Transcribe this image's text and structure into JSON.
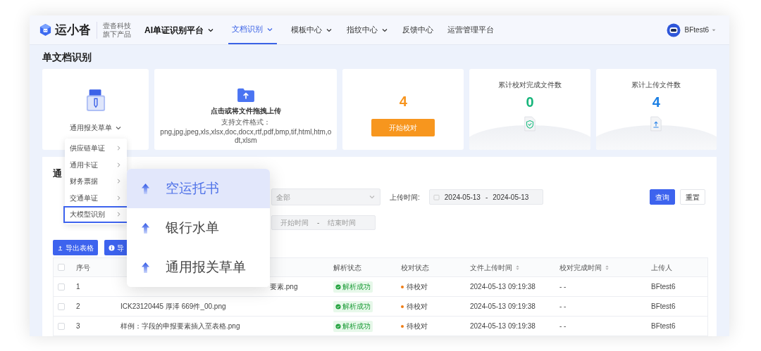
{
  "header": {
    "logo": {
      "name": "运小沓",
      "tagline": [
        "壹沓科技",
        "旗下产品"
      ]
    },
    "nav": [
      {
        "label": "AI单证识别平台",
        "kind": "platform",
        "dropdown": true,
        "selected": false
      },
      {
        "label": "文档识别",
        "kind": "link",
        "dropdown": true,
        "selected": true
      },
      {
        "label": "模板中心",
        "kind": "link",
        "dropdown": true,
        "selected": false
      },
      {
        "label": "指纹中心",
        "kind": "link",
        "dropdown": true,
        "selected": false
      },
      {
        "label": "反馈中心",
        "kind": "link",
        "dropdown": false,
        "selected": false
      },
      {
        "label": "运营管理平台",
        "kind": "link",
        "dropdown": false,
        "selected": false
      }
    ],
    "user": {
      "name": "BFtest6"
    }
  },
  "page_title": "单文档识别",
  "doc_type_card": {
    "value": "通用报关草单"
  },
  "upload_card": {
    "title": "点击或将文件拖拽上传",
    "formats_label": "支持文件格式：",
    "formats": "png,jpg,jpeg,xls,xlsx,doc,docx,rtf,pdf,bmp,tif,html,htm,odt,xlsm"
  },
  "pending_card": {
    "count": "4",
    "button": "开始校对"
  },
  "stats": [
    {
      "label": "累计校对完成文件数",
      "value": "0",
      "kind": "check"
    },
    {
      "label": "累计上传文件数",
      "value": "4",
      "kind": "upload"
    }
  ],
  "list_panel": {
    "title": "通",
    "filters": {
      "status_select": {
        "placeholder": "全部"
      },
      "upload_time": {
        "label": "上传时间:",
        "start": "2024-05-13",
        "separator": "-",
        "end": "2024-05-13"
      },
      "check_time": {
        "start_placeholder": "开始时间",
        "separator": "-",
        "end_placeholder": "结束时间"
      },
      "buttons": [
        {
          "label": "查询",
          "kind": "primary"
        },
        {
          "label": "重置",
          "kind": "default"
        }
      ]
    },
    "actions": [
      {
        "label": "导出表格",
        "kind": "upload"
      },
      {
        "label": "导",
        "kind": "info"
      }
    ],
    "table": {
      "select_all_checked": false,
      "columns": [
        {
          "label": "序号",
          "sortable": false
        },
        {
          "label": "解析状态",
          "sortable": false
        },
        {
          "label": "校对状态",
          "sortable": false
        },
        {
          "label": "文件上传时间",
          "sortable": true
        },
        {
          "label": "校对完成时间",
          "sortable": true
        },
        {
          "label": "上传人",
          "sortable": false
        }
      ],
      "rows": [
        {
          "checked": false,
          "index": "1",
          "file_name": "要素.png",
          "parse_status": "解析成功",
          "check_status": "待校对",
          "upload_time": "2024-05-13 09:19:38",
          "check_time": "- -",
          "uploader": "BFtest6"
        },
        {
          "checked": false,
          "index": "2",
          "file_name": "ICK23120445 厚泽 669件_00.png",
          "parse_status": "解析成功",
          "check_status": "待校对",
          "upload_time": "2024-05-13 09:19:38",
          "check_time": "- -",
          "uploader": "BFtest6"
        },
        {
          "checked": false,
          "index": "3",
          "file_name": "样例：字段的申报要素插入至表格.png",
          "parse_status": "解析成功",
          "check_status": "待校对",
          "upload_time": "2024-05-13 09:19:38",
          "check_time": "- -",
          "uploader": "BFtest6"
        }
      ]
    }
  },
  "category_menu": [
    {
      "label": "供应链单证",
      "selected": false
    },
    {
      "label": "通用卡证",
      "selected": false
    },
    {
      "label": "财务票据",
      "selected": false
    },
    {
      "label": "交通单证",
      "selected": false
    },
    {
      "label": "大模型识别",
      "selected": true
    }
  ],
  "submenu": [
    {
      "label": "空运托书",
      "selected": true
    },
    {
      "label": "银行水单",
      "selected": false
    },
    {
      "label": "通用报关草单",
      "selected": false
    }
  ]
}
